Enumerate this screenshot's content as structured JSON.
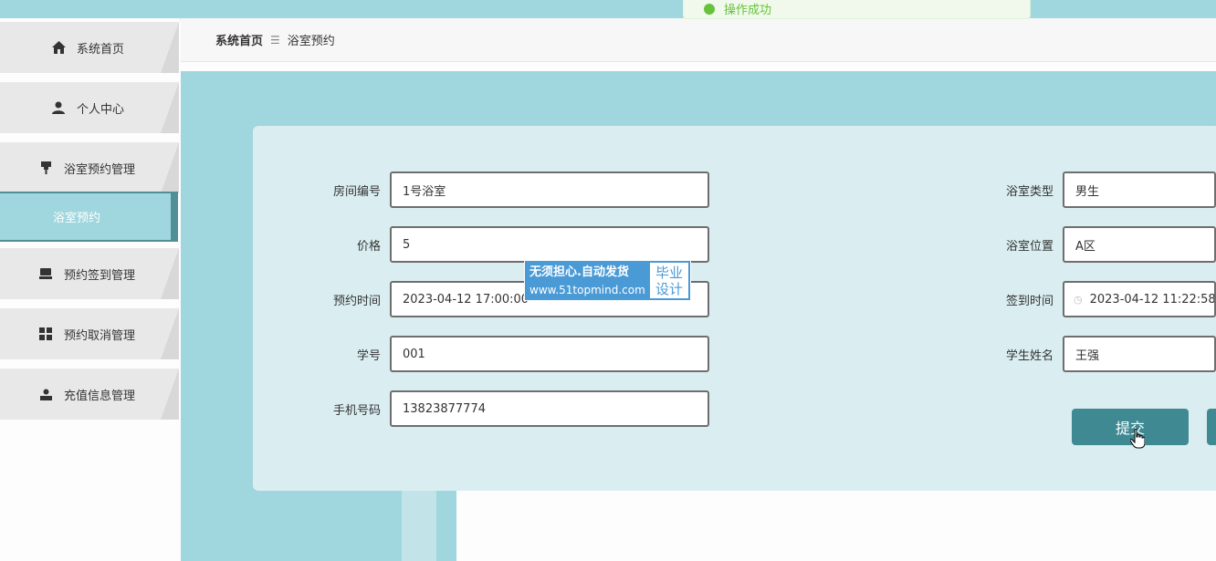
{
  "toast": {
    "text": "操作成功"
  },
  "sidebar": {
    "items": [
      {
        "label": "系统首页",
        "icon": "home-icon"
      },
      {
        "label": "个人中心",
        "icon": "user-icon"
      },
      {
        "label": "浴室预约管理",
        "icon": "shower-icon"
      },
      {
        "label": "预约签到管理",
        "icon": "checkin-icon"
      },
      {
        "label": "预约取消管理",
        "icon": "grid-icon"
      },
      {
        "label": "充值信息管理",
        "icon": "person-icon"
      }
    ],
    "active_sub": {
      "label": "浴室预约"
    }
  },
  "breadcrumb": {
    "home": "系统首页",
    "separator": "☰",
    "current": "浴室预约"
  },
  "form": {
    "room_no": {
      "label": "房间编号",
      "value": "1号浴室"
    },
    "bath_type": {
      "label": "浴室类型",
      "value": "男生"
    },
    "price": {
      "label": "价格",
      "value": "5"
    },
    "bath_location": {
      "label": "浴室位置",
      "value": "A区"
    },
    "reserve_time": {
      "label": "预约时间",
      "value": "2023-04-12 17:00:00"
    },
    "checkin_time": {
      "label": "签到时间",
      "value": "2023-04-12 11:22:58"
    },
    "student_no": {
      "label": "学号",
      "value": "001"
    },
    "student_name": {
      "label": "学生姓名",
      "value": "王强"
    },
    "phone": {
      "label": "手机号码",
      "value": "13823877774"
    },
    "submit_label": "提交"
  },
  "watermark": {
    "line1": "无须担心.自动发货",
    "line2": "www.51topmind.com",
    "tag1": "毕业",
    "tag2": "设计"
  },
  "colors": {
    "accent": "#a0d6de",
    "button": "#3f8a92",
    "card": "#daeef1"
  }
}
